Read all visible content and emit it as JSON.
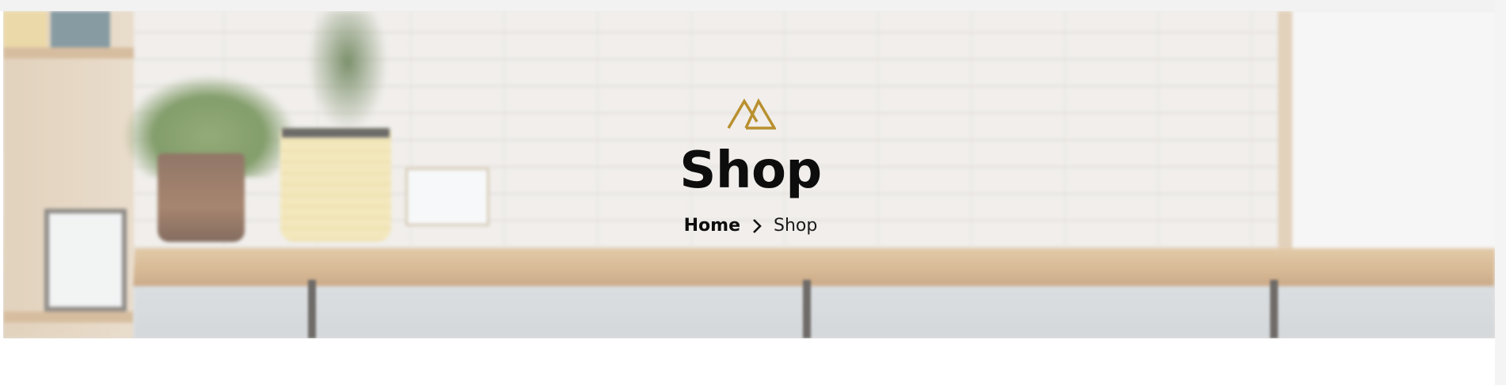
{
  "hero": {
    "logo_icon": "mountain-logo-icon",
    "title": "Shop",
    "breadcrumb": {
      "home_label": "Home",
      "separator_icon": "chevron-right-icon",
      "current_label": "Shop"
    }
  },
  "colors": {
    "logo_gold": "#b9902f",
    "title_text": "#0d0d0d",
    "page_background": "#ffffff"
  },
  "background_image": "blurred-shop-interior-photo"
}
